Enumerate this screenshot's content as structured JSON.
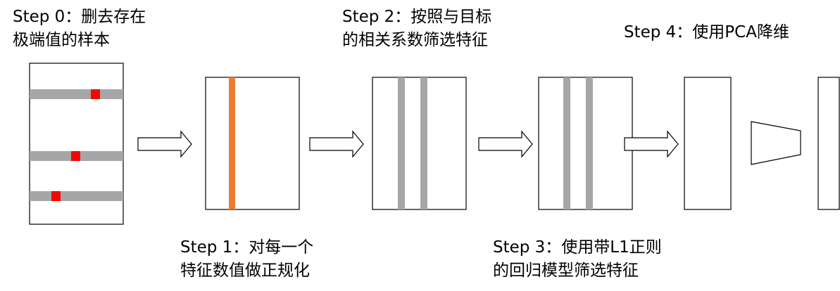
{
  "colors": {
    "outline": "#000000",
    "gray_bar": "#a6a6a6",
    "outlier": "#ff0000",
    "normalized_column": "#ed7d31",
    "background": "#ffffff"
  },
  "steps": [
    {
      "id": "step0",
      "line1": "Step 0：删去存在",
      "line2": "极端值的样本"
    },
    {
      "id": "step1",
      "line1": "Step 1：对每一个",
      "line2": "特征数值做正规化"
    },
    {
      "id": "step2",
      "line1": "Step 2：按照与目标",
      "line2": "的相关系数筛选特征"
    },
    {
      "id": "step3",
      "line1": "Step 3：使用带L1正则",
      "line2": "的回归模型筛选特征"
    },
    {
      "id": "step4",
      "line1": "Step 4：使用PCA降维",
      "line2": ""
    }
  ]
}
